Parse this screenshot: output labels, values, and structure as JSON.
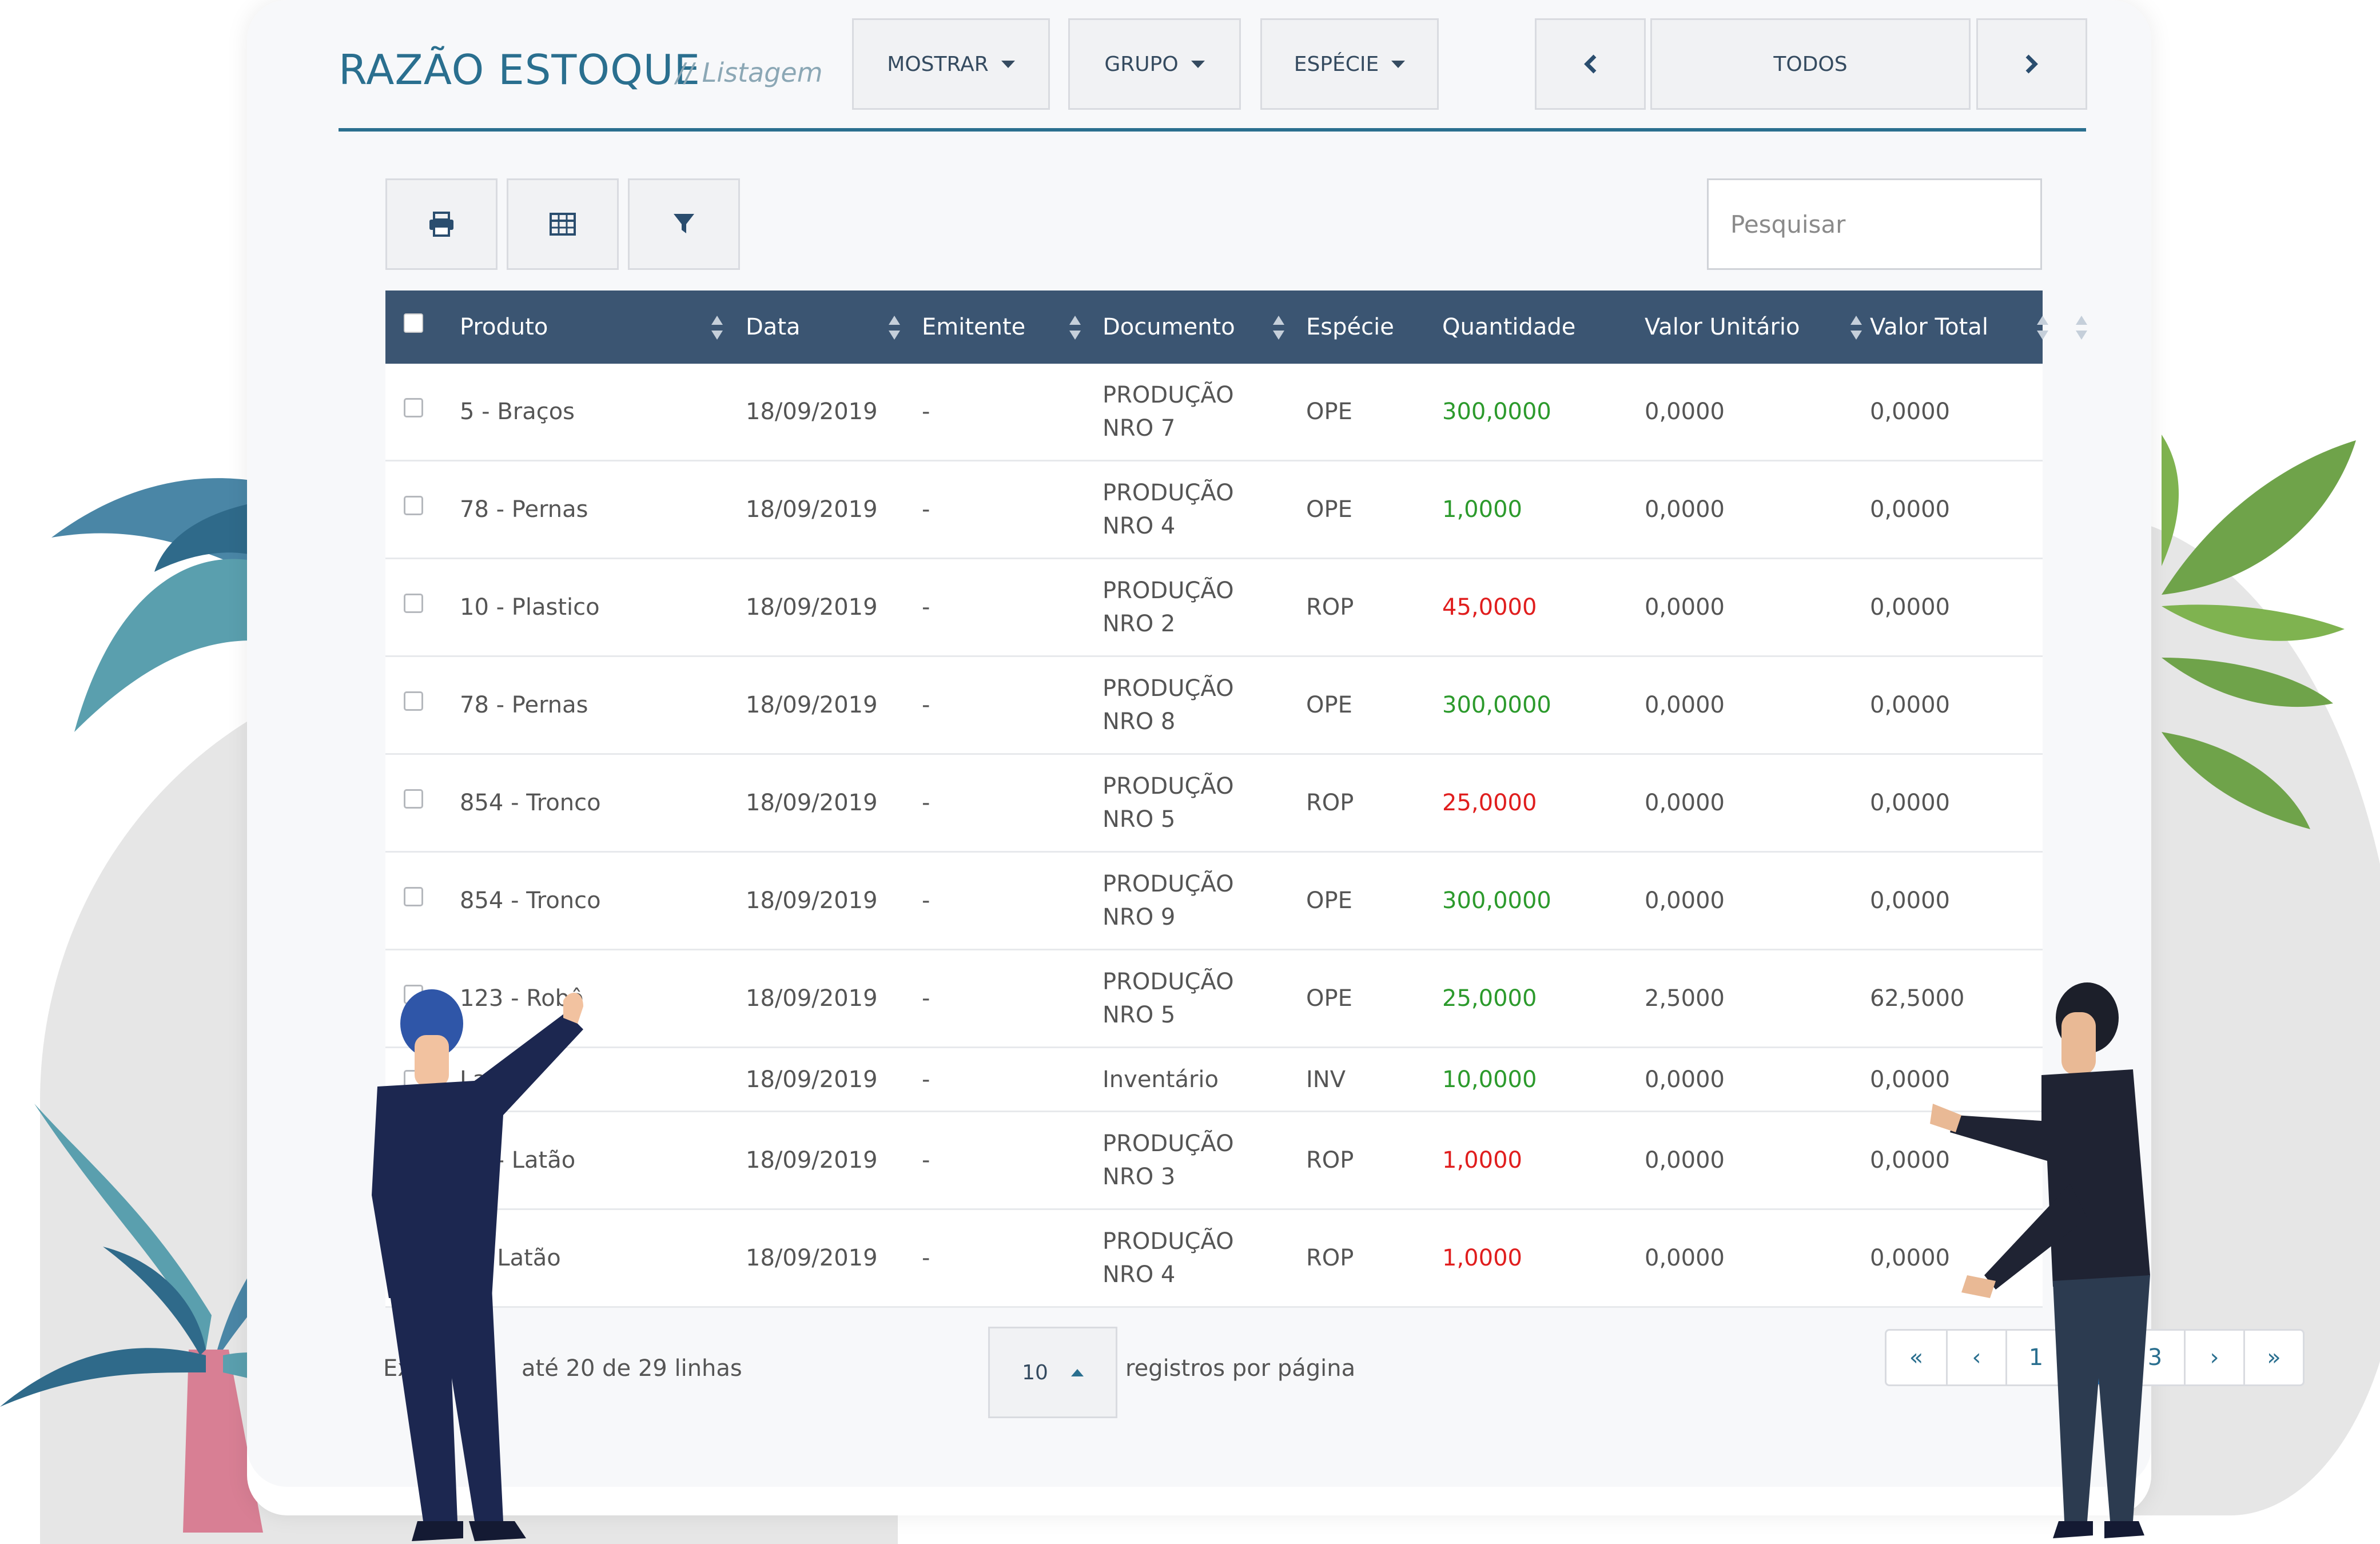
{
  "header": {
    "title": "RAZÃO ESTOQUE",
    "subtitle": "// Listagem",
    "mostrar": "MOSTRAR",
    "grupo": "GRUPO",
    "especie": "ESPÉCIE",
    "period": "TODOS"
  },
  "toolbar": {
    "search_placeholder": "Pesquisar"
  },
  "table": {
    "columns": [
      "Produto",
      "Data",
      "Emitente",
      "Documento",
      "Espécie",
      "Quantidade",
      "Valor Unitário",
      "Valor Total"
    ],
    "rows": [
      {
        "produto": "5 - Braços",
        "data": "18/09/2019",
        "emitente": "-",
        "doc1": "PRODUÇÃO",
        "doc2": "NRO 7",
        "especie": "OPE",
        "quantidade": "300,0000",
        "qty_type": "in",
        "unitario": "0,0000",
        "total": "0,0000"
      },
      {
        "produto": "78 - Pernas",
        "data": "18/09/2019",
        "emitente": "-",
        "doc1": "PRODUÇÃO",
        "doc2": "NRO 4",
        "especie": "OPE",
        "quantidade": "1,0000",
        "qty_type": "in",
        "unitario": "0,0000",
        "total": "0,0000"
      },
      {
        "produto": "10 - Plastico",
        "data": "18/09/2019",
        "emitente": "-",
        "doc1": "PRODUÇÃO",
        "doc2": "NRO 2",
        "especie": "ROP",
        "quantidade": "45,0000",
        "qty_type": "out",
        "unitario": "0,0000",
        "total": "0,0000"
      },
      {
        "produto": "78 - Pernas",
        "data": "18/09/2019",
        "emitente": "-",
        "doc1": "PRODUÇÃO",
        "doc2": "NRO 8",
        "especie": "OPE",
        "quantidade": "300,0000",
        "qty_type": "in",
        "unitario": "0,0000",
        "total": "0,0000"
      },
      {
        "produto": "854 - Tronco",
        "data": "18/09/2019",
        "emitente": "-",
        "doc1": "PRODUÇÃO",
        "doc2": "NRO 5",
        "especie": "ROP",
        "quantidade": "25,0000",
        "qty_type": "out",
        "unitario": "0,0000",
        "total": "0,0000"
      },
      {
        "produto": "854 - Tronco",
        "data": "18/09/2019",
        "emitente": "-",
        "doc1": "PRODUÇÃO",
        "doc2": "NRO 9",
        "especie": "OPE",
        "quantidade": "300,0000",
        "qty_type": "in",
        "unitario": "0,0000",
        "total": "0,0000"
      },
      {
        "produto": "123 - Robô",
        "data": "18/09/2019",
        "emitente": "-",
        "doc1": "PRODUÇÃO",
        "doc2": "NRO 5",
        "especie": "OPE",
        "quantidade": "25,0000",
        "qty_type": "in",
        "unitario": "2,5000",
        "total": "62,5000"
      },
      {
        "produto": "Latão",
        "data": "18/09/2019",
        "emitente": "-",
        "doc1": "Inventário",
        "doc2": "",
        "especie": "INV",
        "quantidade": "10,0000",
        "qty_type": "in",
        "unitario": "0,0000",
        "total": "0,0000"
      },
      {
        "produto": "65 - Latão",
        "data": "18/09/2019",
        "emitente": "-",
        "doc1": "PRODUÇÃO",
        "doc2": "NRO 3",
        "especie": "ROP",
        "quantidade": "1,0000",
        "qty_type": "out",
        "unitario": "0,0000",
        "total": "0,0000"
      },
      {
        "produto": "5 - Latão",
        "data": "18/09/2019",
        "emitente": "-",
        "doc1": "PRODUÇÃO",
        "doc2": "NRO 4",
        "especie": "ROP",
        "quantidade": "1,0000",
        "qty_type": "out",
        "unitario": "0,0000",
        "total": "0,0000"
      }
    ]
  },
  "footer": {
    "showing": "até 20 de 29 linhas",
    "per_page": "10",
    "per_page_label": "registros por página"
  },
  "pagination": {
    "first": "«",
    "prev": "‹",
    "pages": [
      "1",
      "2",
      "3"
    ],
    "active_page": "2",
    "next": "›",
    "last": "»"
  },
  "colors": {
    "primary": "#2a6f8f",
    "table_header": "#3b5572",
    "qty_in": "#2c9a2c",
    "qty_out": "#e01e1e",
    "active_page": "#2a7bc4"
  },
  "icons": [
    "print-icon",
    "table-icon",
    "filter-icon",
    "chevron-left-icon",
    "chevron-right-icon",
    "caret-down-icon",
    "sort-icon"
  ]
}
